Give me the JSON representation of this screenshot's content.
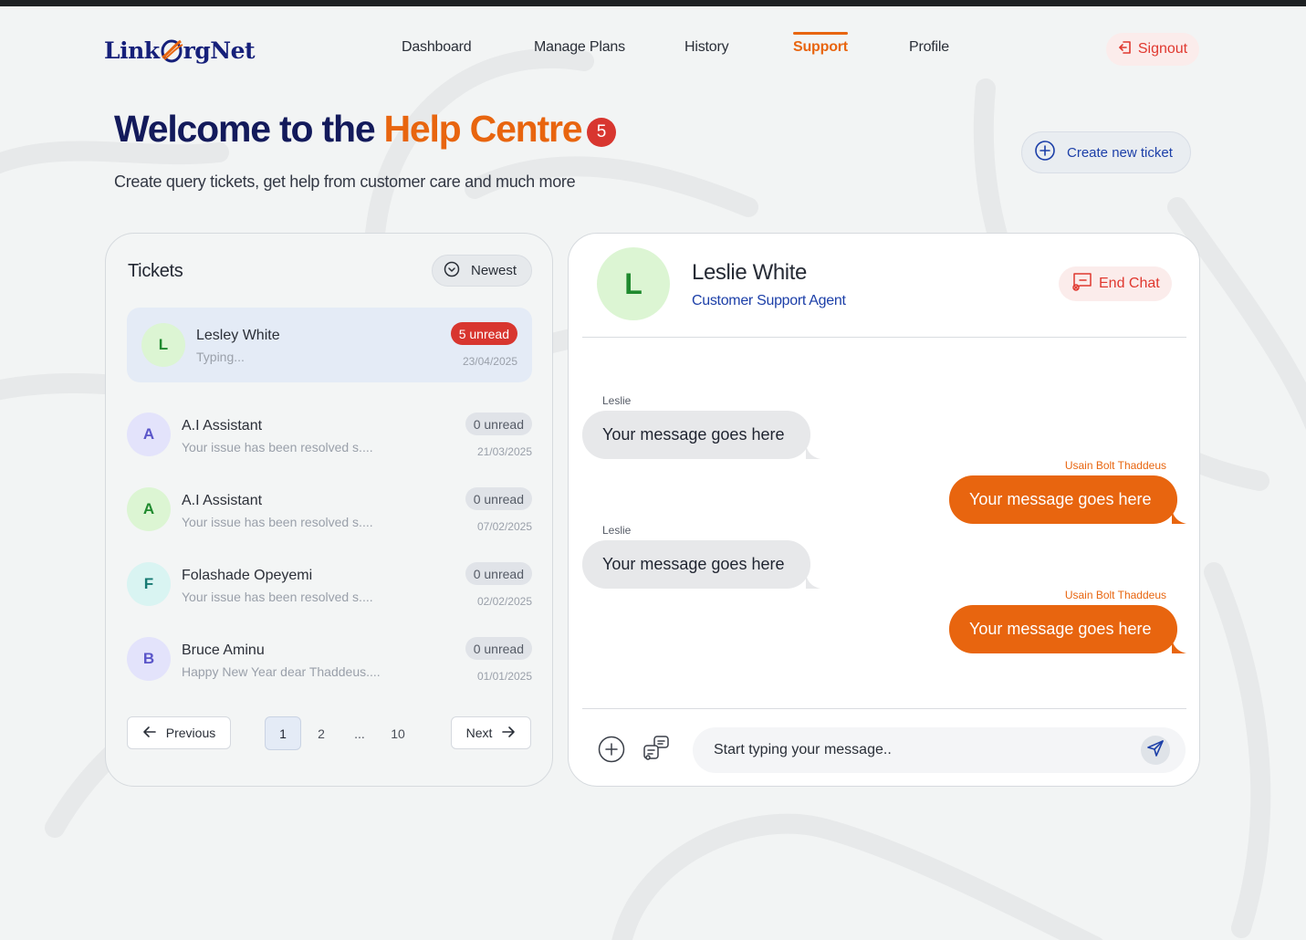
{
  "nav": {
    "logo_part1": "Link",
    "logo_part2": "rgNet",
    "links": [
      "Dashboard",
      "Manage Plans",
      "History",
      "Support",
      "Profile"
    ],
    "active": "Support",
    "signout": "Signout"
  },
  "hero": {
    "title_part1": "Welcome to the",
    "title_part2": "Help Centre",
    "badge": "5",
    "subtitle": "Create query tickets, get help from customer care and much more",
    "create_button": "Create new ticket"
  },
  "tickets": {
    "title": "Tickets",
    "sort_label": "Newest",
    "items": [
      {
        "initial": "L",
        "name": "Lesley White",
        "preview": "Typing...",
        "unread": "5 unread",
        "date": "23/04/2025"
      },
      {
        "initial": "A",
        "name": "A.I Assistant",
        "preview": "Your issue has been resolved s....",
        "unread": "0 unread",
        "date": "21/03/2025"
      },
      {
        "initial": "A",
        "name": "A.I Assistant",
        "preview": "Your issue has been resolved s....",
        "unread": "0 unread",
        "date": "07/02/2025"
      },
      {
        "initial": "F",
        "name": "Folashade Opeyemi",
        "preview": "Your issue has been resolved s....",
        "unread": "0 unread",
        "date": "02/02/2025"
      },
      {
        "initial": "B",
        "name": "Bruce Aminu",
        "preview": "Happy New Year dear Thaddeus....",
        "unread": "0 unread",
        "date": "01/01/2025"
      }
    ],
    "pagination": {
      "previous": "Previous",
      "next": "Next",
      "pages": [
        "1",
        "2",
        "...",
        "10"
      ],
      "current": "1"
    }
  },
  "chat": {
    "agent_initial": "L",
    "agent_name": "Leslie White",
    "agent_role": "Customer Support Agent",
    "end_chat": "End Chat",
    "messages": [
      {
        "sender": "Leslie",
        "text": "Your message goes here",
        "direction": "in"
      },
      {
        "sender": "Usain Bolt Thaddeus",
        "text": "Your message goes here",
        "direction": "out"
      },
      {
        "sender": "Leslie",
        "text": "Your message goes here",
        "direction": "in"
      },
      {
        "sender": "Usain Bolt Thaddeus",
        "text": "Your message goes here",
        "direction": "out"
      }
    ],
    "input_placeholder": "Start typing your message.."
  },
  "colors": {
    "brand_orange": "#e8650f",
    "brand_navy": "#131a5b",
    "accent_blue": "#1c3fa8",
    "danger_red": "#d8362f"
  }
}
